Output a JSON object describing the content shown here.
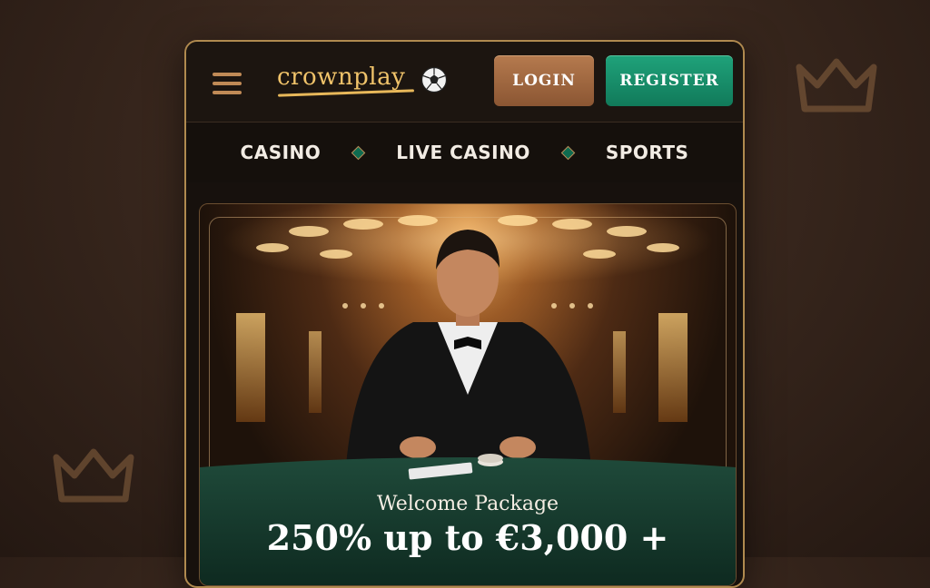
{
  "header": {
    "logo_text": "crownplay",
    "login_label": "LOGIN",
    "register_label": "REGISTER"
  },
  "nav": {
    "items": [
      "CASINO",
      "LIVE CASINO",
      "SPORTS"
    ]
  },
  "banner": {
    "title": "Welcome Package",
    "offer": "250% up to €3,000 +"
  },
  "icons": {
    "menu": "hamburger-icon",
    "ball": "soccer-ball-icon",
    "background_crowns": "crown-icon"
  },
  "colors": {
    "login_button": "#a0673f",
    "register_button": "#17906a",
    "logo": "#f0c36a",
    "accent_border": "#b08a4f"
  }
}
